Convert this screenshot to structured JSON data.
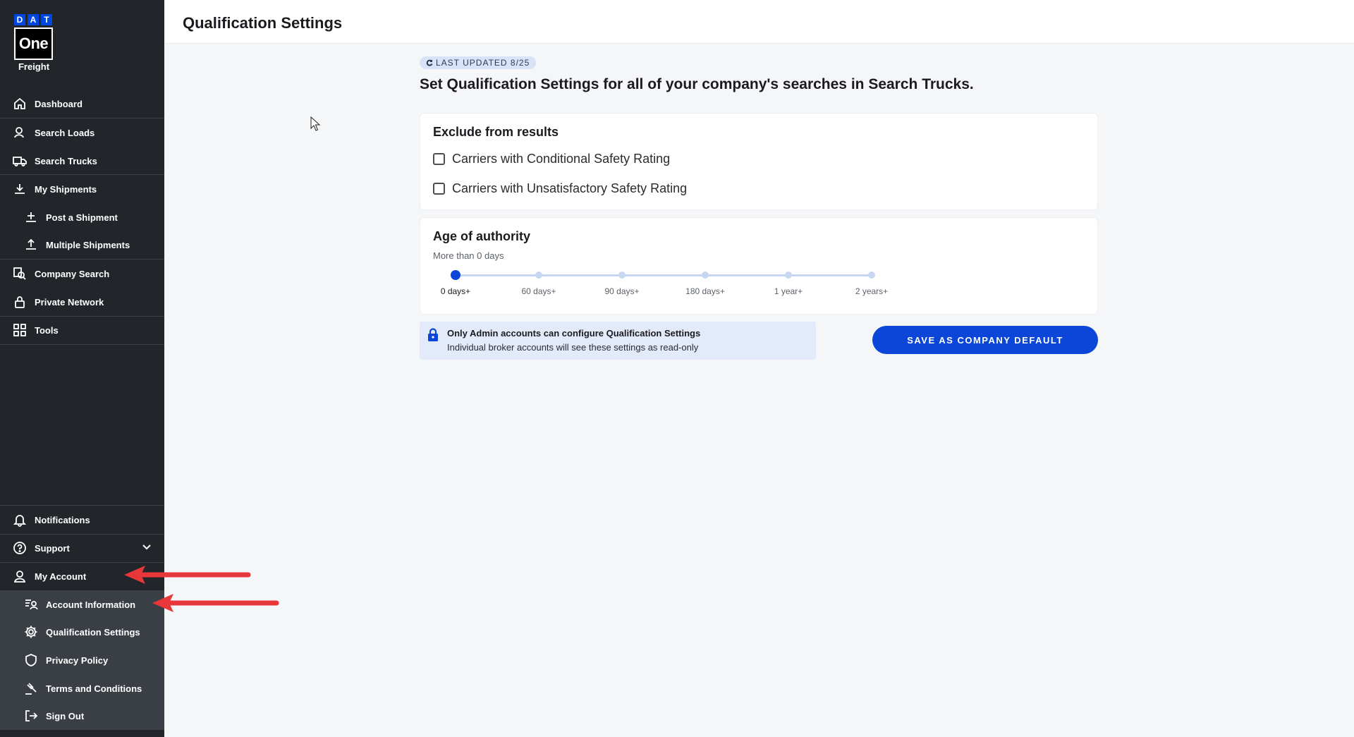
{
  "logo": {
    "letters": [
      "D",
      "A",
      "T"
    ],
    "one": "One",
    "freight": "Freight"
  },
  "sidebar": {
    "items": [
      {
        "label": "Dashboard",
        "icon": "home-icon"
      },
      {
        "label": "Search Loads",
        "icon": "search-loads-icon"
      },
      {
        "label": "Search Trucks",
        "icon": "truck-icon"
      },
      {
        "label": "My Shipments",
        "icon": "shipments-icon"
      },
      {
        "label": "Post a Shipment",
        "icon": "post-shipment-icon"
      },
      {
        "label": "Multiple Shipments",
        "icon": "multiple-shipments-icon"
      },
      {
        "label": "Company Search",
        "icon": "company-search-icon"
      },
      {
        "label": "Private Network",
        "icon": "lock-icon"
      },
      {
        "label": "Tools",
        "icon": "grid-icon"
      }
    ],
    "bottom_items": [
      {
        "label": "Notifications",
        "icon": "bell-icon"
      },
      {
        "label": "Support",
        "icon": "help-icon"
      },
      {
        "label": "My Account",
        "icon": "user-icon"
      },
      {
        "label": "Account Information",
        "icon": "account-info-icon"
      },
      {
        "label": "Qualification Settings",
        "icon": "gear-icon"
      },
      {
        "label": "Privacy Policy",
        "icon": "shield-icon"
      },
      {
        "label": "Terms and Conditions",
        "icon": "gavel-icon"
      },
      {
        "label": "Sign Out",
        "icon": "sign-out-icon"
      }
    ]
  },
  "header": {
    "title": "Qualification Settings"
  },
  "main": {
    "badge": "LAST UPDATED 8/25",
    "headline": "Set Qualification Settings for all of your company's searches in Search Trucks.",
    "exclude": {
      "title": "Exclude from results",
      "options": [
        {
          "label": "Carriers with Conditional Safety Rating",
          "checked": false
        },
        {
          "label": "Carriers with Unsatisfactory Safety Rating",
          "checked": false
        }
      ]
    },
    "age": {
      "title": "Age of authority",
      "subtitle": "More than 0 days",
      "ticks": [
        "0 days+",
        "60 days+",
        "90 days+",
        "180 days+",
        "1 year+",
        "2 years+"
      ],
      "selected_index": 0
    },
    "info": {
      "title": "Only Admin accounts can configure Qualification Settings",
      "description": "Individual broker accounts will see these settings as read-only"
    },
    "save_label": "SAVE AS COMPANY DEFAULT"
  },
  "colors": {
    "accent": "#0b46d8",
    "sidebar": "#22262b",
    "annotation": "#e8373a"
  }
}
